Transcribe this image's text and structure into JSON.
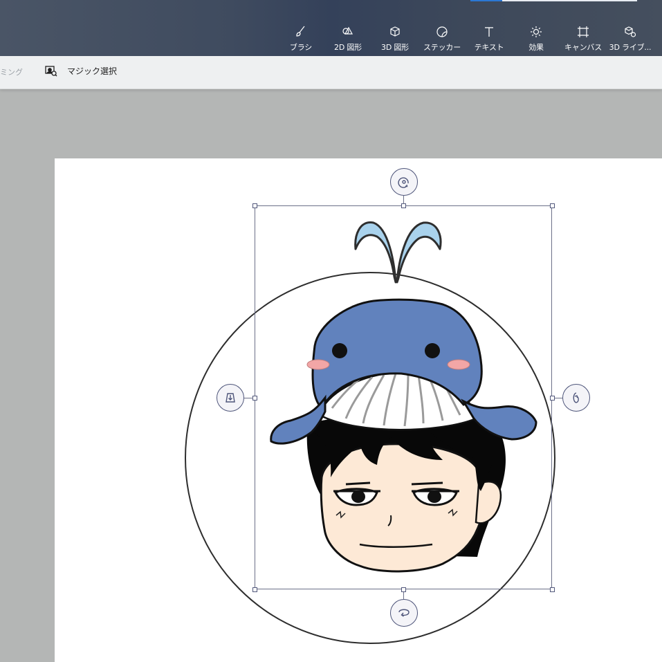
{
  "toolbar": {
    "tools": [
      {
        "label": "ブラシ",
        "icon": "brush-icon"
      },
      {
        "label": "2D 図形",
        "icon": "shapes-2d-icon"
      },
      {
        "label": "3D 図形",
        "icon": "cube-3d-icon"
      },
      {
        "label": "ステッカー",
        "icon": "sticker-icon"
      },
      {
        "label": "テキスト",
        "icon": "text-icon"
      },
      {
        "label": "効果",
        "icon": "effects-sun-icon"
      },
      {
        "label": "キャンバス",
        "icon": "canvas-icon"
      },
      {
        "label": "3D ライブ...",
        "icon": "3d-library-icon"
      }
    ]
  },
  "subbar": {
    "trim_label": "ミング",
    "magic_select_label": "マジック選択"
  },
  "colors": {
    "toolbar_bg": "#3f4b5f",
    "accent": "#2b78d4",
    "whale_blue": "#6182bd",
    "spout_blue": "#a9d2ec",
    "skin": "#fde9d6",
    "cheek_pink": "#f2a6a6",
    "handle_stroke": "#4d5479"
  },
  "canvas": {
    "content": "chibi-boy-whale-hat-sticker"
  }
}
